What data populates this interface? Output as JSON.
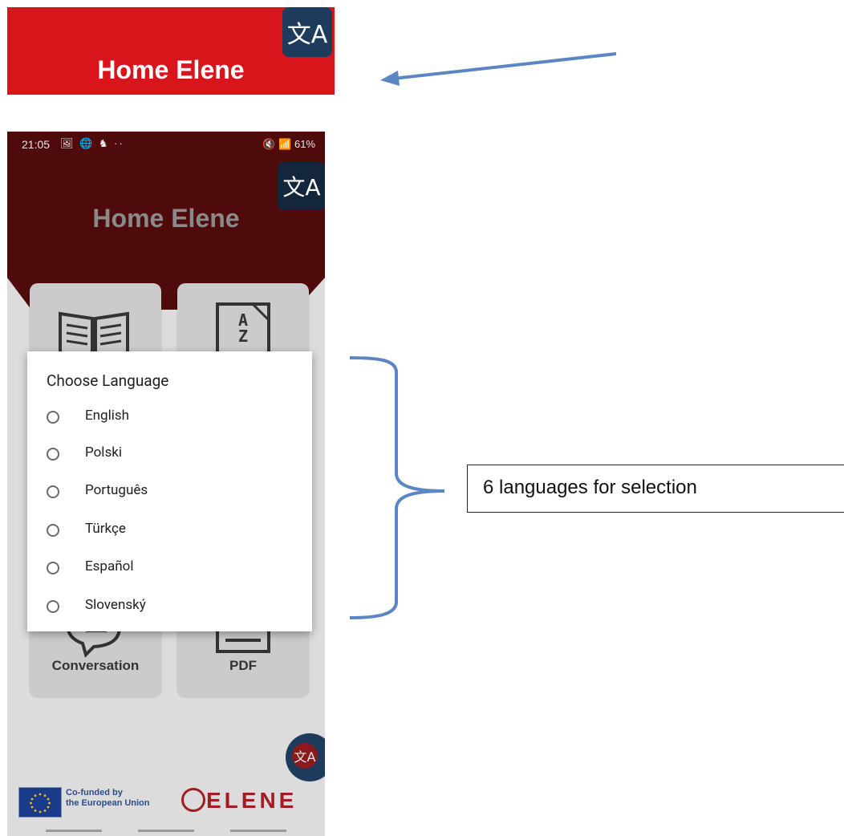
{
  "zoom_crop": {
    "title": "Home Elene",
    "translate_icon": "文A"
  },
  "status_bar": {
    "time": "21:05",
    "left_icons": "🖼 🌐 ♞ ··",
    "right": "🔇 📶 61%"
  },
  "app": {
    "header_title": "Home Elene",
    "translate_icon": "文A",
    "tiles": [
      {
        "label": "Conversation",
        "icon": "speech-bubble-icon"
      },
      {
        "label": "PDF",
        "icon": "document-icon"
      }
    ],
    "az_icon": {
      "a": "A",
      "z": "Z"
    },
    "fab_icon": "文A",
    "footer": {
      "eu_line1": "Co-funded by",
      "eu_line2": "the European Union",
      "logo": "ELENE"
    }
  },
  "dialog": {
    "title": "Choose Language",
    "options": [
      {
        "label": "English"
      },
      {
        "label": "Polski"
      },
      {
        "label": "Português"
      },
      {
        "label": "Türkçe"
      },
      {
        "label": "Español"
      },
      {
        "label": "Slovenský"
      }
    ]
  },
  "annotation": {
    "callout": "6 languages for selection",
    "color": "#5b86c4"
  },
  "colors": {
    "header_red": "#d9151c",
    "dim_header": "#4f0a0c",
    "button_navy": "#1e3a5c",
    "logo_red": "#a01e22"
  }
}
